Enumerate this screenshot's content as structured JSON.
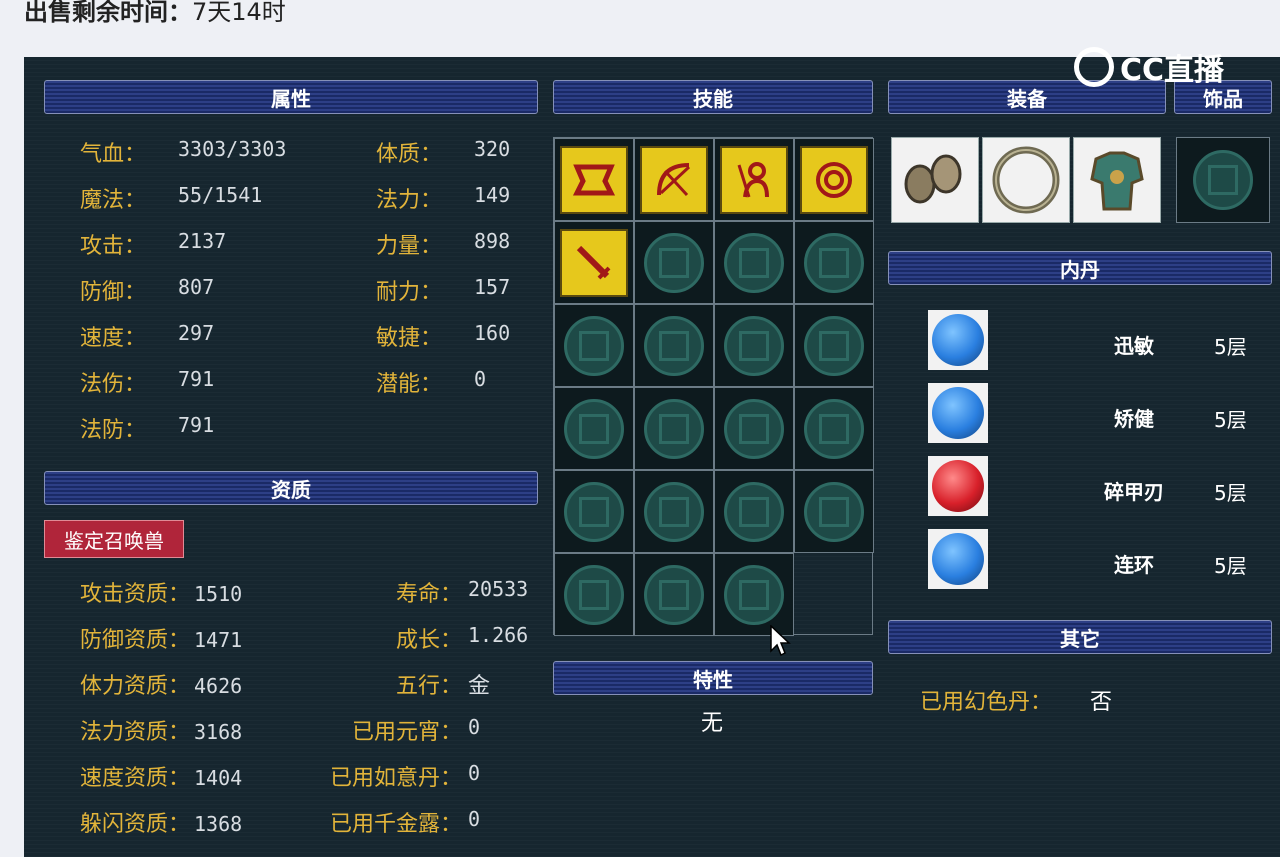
{
  "header": {
    "label": "出售剩余时间：",
    "value": "7天14时"
  },
  "watermark": {
    "text": "CC直播"
  },
  "sections": {
    "attributes": "属性",
    "skills": "技能",
    "equipment": "装备",
    "accessory": "饰品",
    "neidan": "内丹",
    "aptitude": "资质",
    "traits": "特性",
    "other": "其它"
  },
  "attributes_left": [
    {
      "label": "气血：",
      "value": "3303/3303"
    },
    {
      "label": "魔法：",
      "value": "55/1541"
    },
    {
      "label": "攻击：",
      "value": "2137"
    },
    {
      "label": "防御：",
      "value": "807"
    },
    {
      "label": "速度：",
      "value": "297"
    },
    {
      "label": "法伤：",
      "value": "791"
    },
    {
      "label": "法防：",
      "value": "791"
    }
  ],
  "attributes_right": [
    {
      "label": "体质：",
      "value": "320"
    },
    {
      "label": "法力：",
      "value": "149"
    },
    {
      "label": "力量：",
      "value": "898"
    },
    {
      "label": "耐力：",
      "value": "157"
    },
    {
      "label": "敏捷：",
      "value": "160"
    },
    {
      "label": "潜能：",
      "value": "0"
    }
  ],
  "identify_button": "鉴定召唤兽",
  "aptitude_left": [
    {
      "label": "攻击资质：",
      "value": "1510"
    },
    {
      "label": "防御资质：",
      "value": "1471"
    },
    {
      "label": "体力资质：",
      "value": "4626"
    },
    {
      "label": "法力资质：",
      "value": "3168"
    },
    {
      "label": "速度资质：",
      "value": "1404"
    },
    {
      "label": "躲闪资质：",
      "value": "1368"
    }
  ],
  "aptitude_right": [
    {
      "label": "寿命：",
      "value": "20533"
    },
    {
      "label": "成长：",
      "value": "1.266"
    },
    {
      "label": "五行：",
      "value": "金"
    },
    {
      "label": "已用元宵：",
      "value": "0"
    },
    {
      "label": "已用如意丹：",
      "value": "0"
    },
    {
      "label": "已用千金露：",
      "value": "0"
    }
  ],
  "skills_icons": [
    "skill-icon-1",
    "skill-icon-2",
    "skill-icon-3",
    "skill-icon-4",
    "skill-icon-5"
  ],
  "traits_value": "无",
  "equipment_icons": [
    "bracer-icon",
    "ring-icon",
    "armor-icon"
  ],
  "neidan": [
    {
      "name": "迅敏",
      "level": "5层",
      "color": "#2a7fe0"
    },
    {
      "name": "矫健",
      "level": "5层",
      "color": "#2a7fe0"
    },
    {
      "name": "碎甲刃",
      "level": "5层",
      "color": "#d8202a"
    },
    {
      "name": "连环",
      "level": "5层",
      "color": "#2a7fe0"
    }
  ],
  "other": {
    "label": "已用幻色丹：",
    "value": "否"
  }
}
